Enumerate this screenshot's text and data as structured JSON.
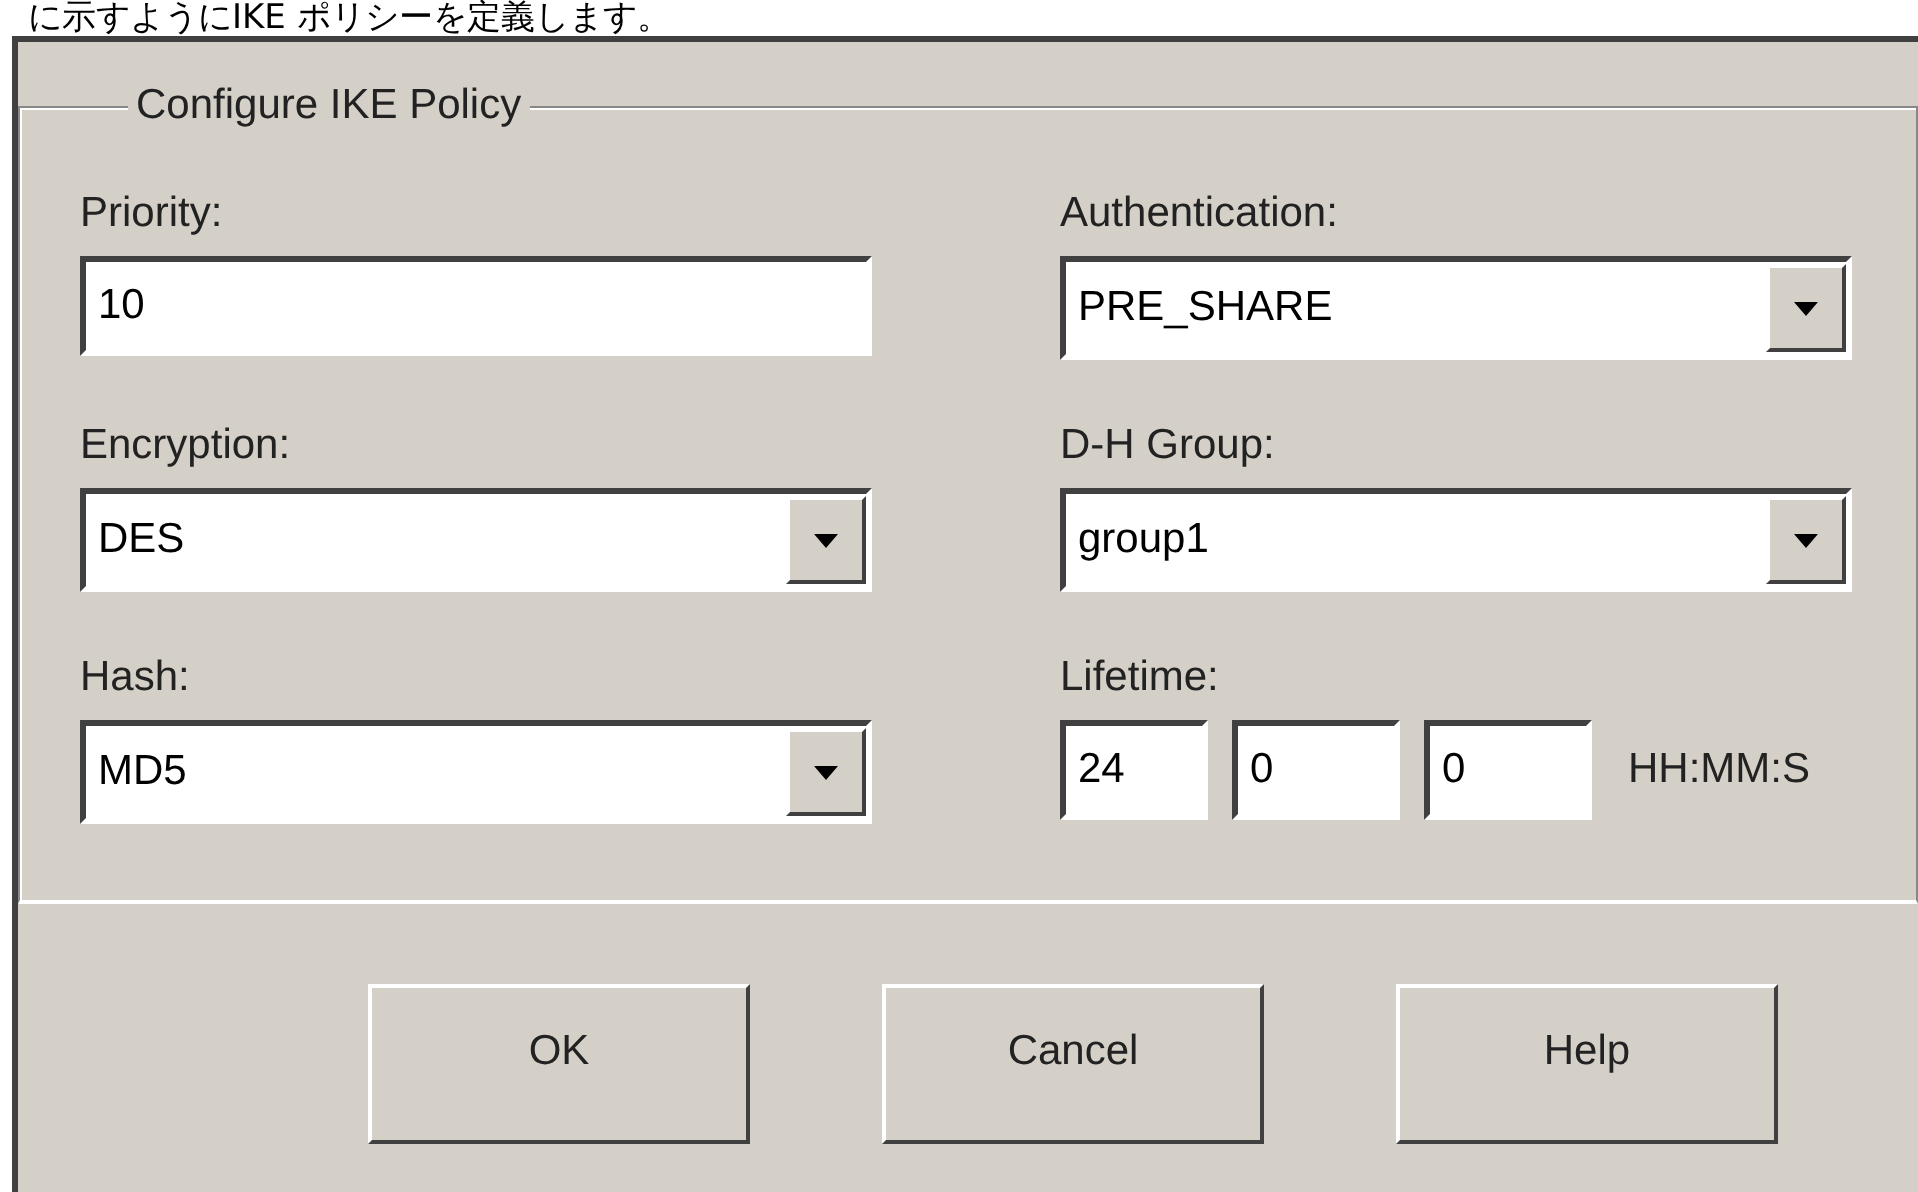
{
  "caption": "に示すようにIKE ポリシーを定義します。",
  "group": {
    "title": "Configure IKE Policy",
    "fields": [
      {
        "label": "Priority:",
        "kind": "text",
        "value": "10"
      },
      {
        "label": "Authentication:",
        "kind": "select",
        "value": "PRE_SHARE"
      },
      {
        "label": "Encryption:",
        "kind": "select",
        "value": "DES"
      },
      {
        "label": "D-H Group:",
        "kind": "select",
        "value": "group1"
      },
      {
        "label": "Hash:",
        "kind": "select",
        "value": "MD5"
      },
      {
        "label": "Lifetime:",
        "kind": "time",
        "values": [
          "24",
          "0",
          "0"
        ],
        "unit": "HH:MM:S"
      }
    ]
  },
  "buttons": [
    "OK",
    "Cancel",
    "Help"
  ]
}
